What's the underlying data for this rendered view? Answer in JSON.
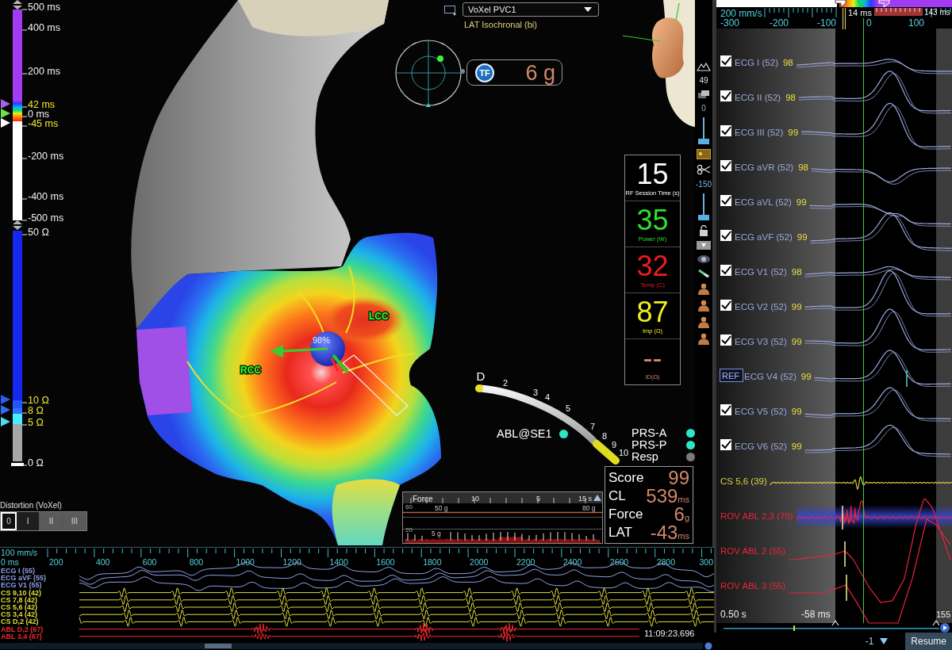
{
  "lat_scale": {
    "labels": [
      {
        "text": "500 ms",
        "highlighted": false
      },
      {
        "text": "400 ms",
        "highlighted": false
      },
      {
        "text": "200 ms",
        "highlighted": false
      },
      {
        "text": "42 ms",
        "highlighted": true,
        "color": "#a564e6"
      },
      {
        "text": "0 ms",
        "highlighted": false,
        "color": "#6fe04a"
      },
      {
        "text": "-45 ms",
        "highlighted": true,
        "color": "#ffffff"
      },
      {
        "text": "-200 ms",
        "highlighted": false
      },
      {
        "text": "-400 ms",
        "highlighted": false
      },
      {
        "text": "-500 ms",
        "highlighted": false
      }
    ]
  },
  "impedance_scale": {
    "labels": [
      {
        "text": "50 Ω",
        "highlighted": false
      },
      {
        "text": "10 Ω",
        "highlighted": true,
        "color": "#2f5cf0"
      },
      {
        "text": "8 Ω",
        "highlighted": true,
        "color": "#2f6cf4"
      },
      {
        "text": "5 Ω",
        "highlighted": true,
        "color": "#52d8f2"
      },
      {
        "text": "0 Ω",
        "highlighted": false
      }
    ]
  },
  "distortion": {
    "title": "Distortion (VoXel)",
    "segments": [
      {
        "label": "0",
        "selected": true,
        "shaded": false
      },
      {
        "label": "I",
        "selected": false,
        "shaded": false
      },
      {
        "label": "II",
        "selected": false,
        "shaded": true
      },
      {
        "label": "III",
        "selected": false,
        "shaded": true
      }
    ]
  },
  "map": {
    "selector": {
      "value": "VoXel PVC1"
    },
    "map_type": "LAT Isochronal (bi)",
    "region_labels": [
      "LCC",
      "RCC"
    ],
    "contact_reading": "98%"
  },
  "force_indicator": {
    "badge": "TF",
    "value": "6 g"
  },
  "rf_panel": [
    {
      "value": "15",
      "label": "RF Session Time (s)",
      "color": "#ffffff"
    },
    {
      "value": "35",
      "label": "Power (W)",
      "color": "#2ee02e"
    },
    {
      "value": "32",
      "label": "Temp (C)",
      "color": "#ee1c1c"
    },
    {
      "value": "87",
      "label": "Imp (Ω)",
      "color": "#f2f01e"
    },
    {
      "value": "--",
      "label": "ID(Ω)",
      "color": "#d2876c"
    }
  ],
  "toolbar": {
    "readings": [
      "49",
      "0",
      "-150"
    ],
    "sliders": [
      {
        "level": 0
      },
      {
        "level": 0
      }
    ]
  },
  "catheter": {
    "electrodes": [
      "D",
      "2",
      "3",
      "4",
      "5",
      "7",
      "8",
      "9",
      "10"
    ],
    "status": [
      {
        "label": "ABL@SE1",
        "color": "#2ee6c4"
      },
      {
        "label": "PRS-A",
        "color": "#2ee6c4"
      },
      {
        "label": "PRS-P",
        "color": "#2ee6c4"
      },
      {
        "label": "Resp",
        "color": "#7a7a7a"
      }
    ]
  },
  "score_panel": [
    {
      "label": "Score",
      "value": "99"
    },
    {
      "label": "CL",
      "value": "539",
      "unit": "ms"
    },
    {
      "label": "Force",
      "value": "6",
      "unit": "g"
    },
    {
      "label": "LAT",
      "value": "-43",
      "unit": "ms"
    }
  ],
  "force_chart": {
    "title": "Force",
    "time_labels": [
      "10",
      "5",
      "15 s"
    ],
    "axis_labels": [
      "60",
      "20"
    ],
    "limit_labels": [
      "50 g",
      "80 g"
    ],
    "reading": "5 g"
  },
  "strip": {
    "speed": "100 mm/s",
    "origin": "0 ms",
    "ticks": [
      "200",
      "400",
      "600",
      "800",
      "1000",
      "1200",
      "1400",
      "1600",
      "1800",
      "2000",
      "2200",
      "2400",
      "2600",
      "2800",
      "300"
    ],
    "channels": [
      {
        "name": "ECG I (55)",
        "color": "#8c9ce0"
      },
      {
        "name": "ECG aVF (55)",
        "color": "#8c9ce0"
      },
      {
        "name": "ECG V1 (55)",
        "color": "#8c9ce0"
      },
      {
        "name": "CS 9,10 (42)",
        "color": "#e0dc3c"
      },
      {
        "name": "CS 7,8 (42)",
        "color": "#e0dc3c"
      },
      {
        "name": "CS 5,6 (42)",
        "color": "#e0dc3c"
      },
      {
        "name": "CS 3,4 (42)",
        "color": "#e0dc3c"
      },
      {
        "name": "CS D,2 (42)",
        "color": "#e0dc3c"
      },
      {
        "name": "ABL D,2 (67)",
        "color": "#f0282c"
      },
      {
        "name": "ABL 3,4 (67)",
        "color": "#f0282c"
      }
    ],
    "timestamp": "11:09:23.696"
  },
  "ecg_panel": {
    "speed": "200 mm/s",
    "ticks": [
      "-300",
      "-200",
      "-100",
      "0",
      "100"
    ],
    "window_start": "14 ms",
    "window_end": "143 ms",
    "channels": [
      {
        "name": "ECG I (52)",
        "quality": "98",
        "kind": "check",
        "checked": true,
        "selected": false,
        "color": "#9ca8dc"
      },
      {
        "name": "ECG II (52)",
        "quality": "98",
        "kind": "check",
        "checked": true,
        "selected": false,
        "color": "#9ca8dc"
      },
      {
        "name": "ECG III (52)",
        "quality": "99",
        "kind": "check",
        "checked": true,
        "selected": false,
        "color": "#9ca8dc"
      },
      {
        "name": "ECG aVR (52)",
        "quality": "98",
        "kind": "check",
        "checked": true,
        "selected": false,
        "color": "#9ca8dc"
      },
      {
        "name": "ECG aVL (52)",
        "quality": "99",
        "kind": "check",
        "checked": true,
        "selected": false,
        "color": "#9ca8dc"
      },
      {
        "name": "ECG aVF (52)",
        "quality": "99",
        "kind": "check",
        "checked": true,
        "selected": false,
        "color": "#9ca8dc"
      },
      {
        "name": "ECG V1 (52)",
        "quality": "98",
        "kind": "check",
        "checked": true,
        "selected": false,
        "color": "#9ca8dc"
      },
      {
        "name": "ECG V2 (52)",
        "quality": "99",
        "kind": "check",
        "checked": true,
        "selected": false,
        "color": "#9ca8dc"
      },
      {
        "name": "ECG V3 (52)",
        "quality": "99",
        "kind": "check",
        "checked": true,
        "selected": false,
        "color": "#9ca8dc"
      },
      {
        "name": "ECG V4 (52)",
        "quality": "99",
        "kind": "ref",
        "badge": "REF",
        "selected": false,
        "color": "#9ca8dc"
      },
      {
        "name": "ECG V5 (52)",
        "quality": "99",
        "kind": "check",
        "checked": true,
        "selected": false,
        "color": "#9ca8dc"
      },
      {
        "name": "ECG V6 (52)",
        "quality": "99",
        "kind": "check",
        "checked": true,
        "selected": false,
        "color": "#9ca8dc"
      },
      {
        "name": "CS 5,6 (39)",
        "kind": "plain",
        "selected": false,
        "color": "#d8d040"
      },
      {
        "name": "ROV ABL 2,3 (70)",
        "kind": "plain",
        "selected": true,
        "color": "#e8243c"
      },
      {
        "name": "ROV ABL 2 (55)",
        "kind": "plain",
        "selected": false,
        "color": "#e8243c"
      },
      {
        "name": "ROV ABL 3 (55)",
        "kind": "plain",
        "selected": false,
        "color": "#e8243c"
      }
    ],
    "duration": "0.50 s",
    "offset": "-58 ms",
    "end": "155",
    "step": "-1",
    "resume": "Resume"
  }
}
